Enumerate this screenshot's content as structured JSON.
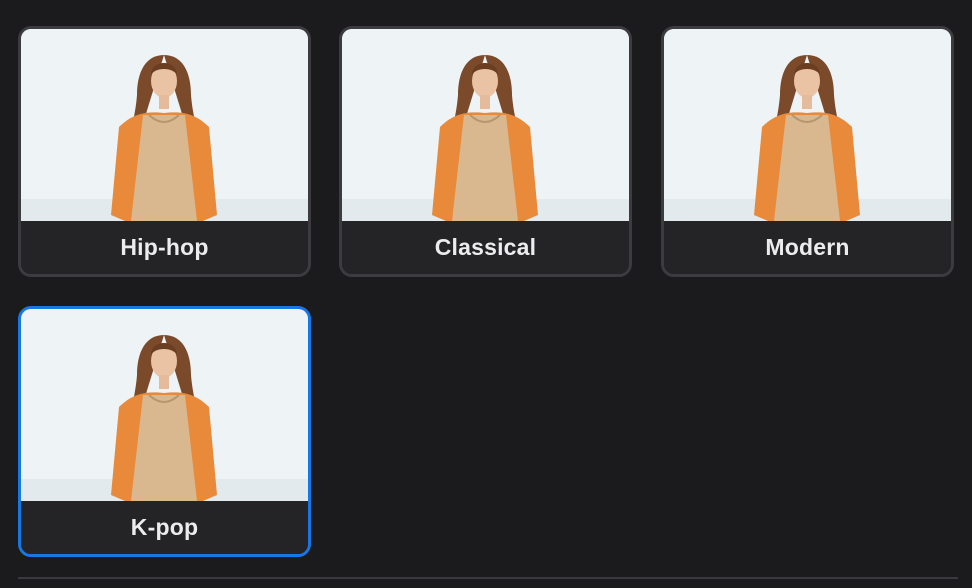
{
  "styles": [
    {
      "label": "Hip-hop",
      "selected": false,
      "image": "woman-orange-cardigan-photo"
    },
    {
      "label": "Classical",
      "selected": false,
      "image": "woman-orange-cardigan-photo"
    },
    {
      "label": "Modern",
      "selected": false,
      "image": "woman-orange-cardigan-photo"
    },
    {
      "label": "K-pop",
      "selected": true,
      "image": "woman-orange-cardigan-photo"
    }
  ],
  "colors": {
    "background": "#1b1b1d",
    "card_border": "#3c3c40",
    "selected_border": "#1677e6",
    "label_text": "#ececee"
  }
}
